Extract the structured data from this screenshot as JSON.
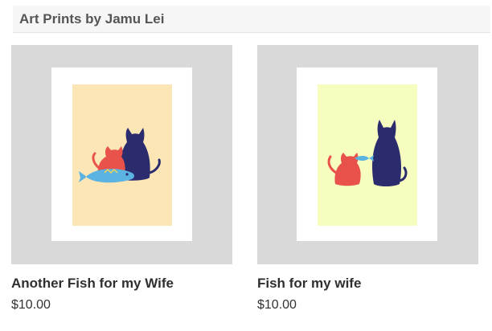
{
  "section": {
    "title": "Art Prints by Jamu Lei"
  },
  "products": [
    {
      "name": "Another Fish for my Wife",
      "price": "$10.00",
      "art_background": "#fce6b6",
      "art_icon": "red-cat-black-cat-fish-illustration"
    },
    {
      "name": "Fish for my wife",
      "price": "$10.00",
      "art_background": "#f6fdbe",
      "art_icon": "red-cat-with-fish-black-cat-illustration"
    }
  ],
  "colors": {
    "header_bg": "#f6f6f6",
    "frame_bg": "#d9d9d9",
    "cat_red": "#e8524a",
    "cat_navy": "#2b2c6e",
    "fish_blue": "#5ab3e0"
  }
}
